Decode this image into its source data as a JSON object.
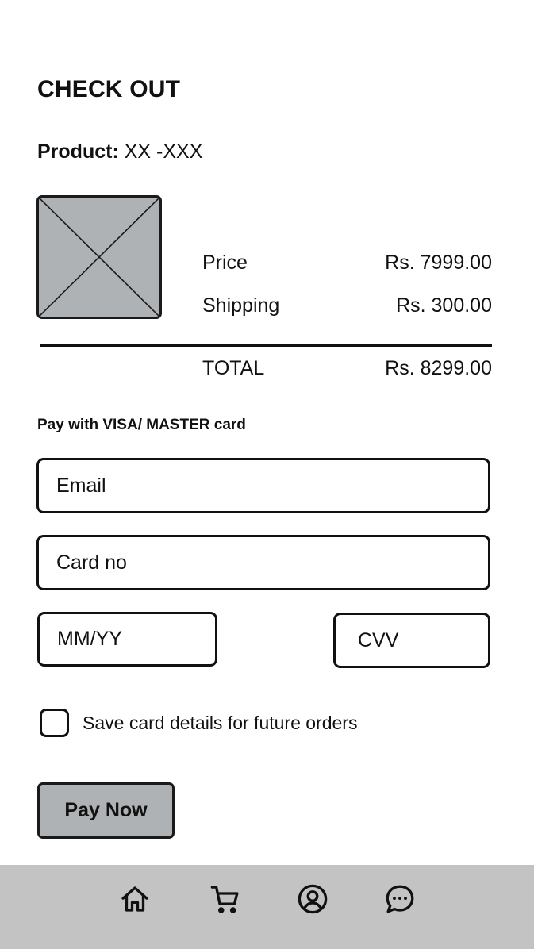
{
  "header": {
    "title": "CHECK OUT"
  },
  "product": {
    "label": "Product:",
    "name": "XX -XXX",
    "image_icon": "image-placeholder-icon"
  },
  "summary": {
    "price_label": "Price",
    "price_value": "Rs. 7999.00",
    "shipping_label": "Shipping",
    "shipping_value": "Rs. 300.00",
    "total_label": "TOTAL",
    "total_value": "Rs. 8299.00"
  },
  "payment": {
    "heading": "Pay with VISA/ MASTER card",
    "email_placeholder": "Email",
    "card_placeholder": "Card no",
    "expiry_placeholder": "MM/YY",
    "cvv_placeholder": "CVV",
    "save_card_label": "Save card details for future orders",
    "save_card_checked": false,
    "pay_button_label": "Pay Now"
  },
  "bottom_nav": {
    "items": [
      {
        "icon": "home-icon"
      },
      {
        "icon": "cart-icon"
      },
      {
        "icon": "profile-icon"
      },
      {
        "icon": "chat-icon"
      }
    ]
  },
  "colors": {
    "placeholder_fill": "#aeb2b5",
    "nav_background": "#c3c3c3",
    "ink": "#111111"
  }
}
